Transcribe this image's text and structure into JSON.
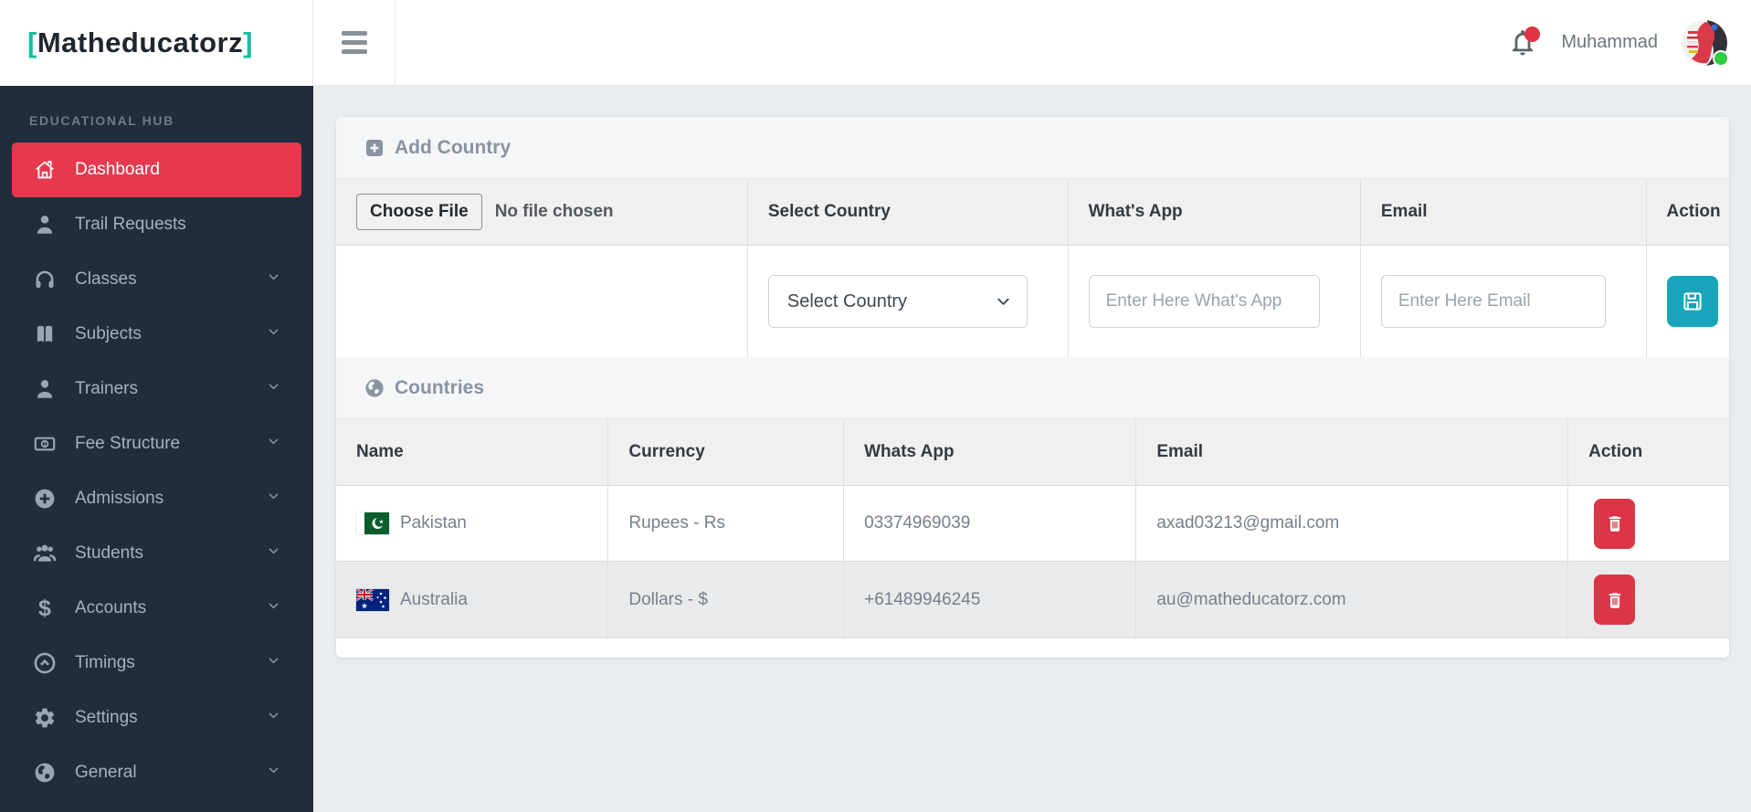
{
  "brand": {
    "bracket_left": "[",
    "name": "Matheducatorz",
    "bracket_right": "]"
  },
  "sidebar": {
    "section_label": "EDUCATIONAL HUB",
    "items": [
      {
        "label": "Dashboard",
        "icon": "home-icon",
        "active": true
      },
      {
        "label": "Trail Requests",
        "icon": "person-icon",
        "active": false
      },
      {
        "label": "Classes",
        "icon": "headphones-icon",
        "active": false
      },
      {
        "label": "Subjects",
        "icon": "book-icon",
        "active": false
      },
      {
        "label": "Trainers",
        "icon": "person-icon",
        "active": false
      },
      {
        "label": "Fee Structure",
        "icon": "money-bill-icon",
        "active": false
      },
      {
        "label": "Admissions",
        "icon": "plus-circle-icon",
        "active": false
      },
      {
        "label": "Students",
        "icon": "users-icon",
        "active": false
      },
      {
        "label": "Accounts",
        "icon": "dollar-icon",
        "active": false
      },
      {
        "label": "Timings",
        "icon": "clock-icon",
        "active": false
      },
      {
        "label": "Settings",
        "icon": "gear-icon",
        "active": false
      },
      {
        "label": "General",
        "icon": "globe-icon",
        "active": false
      }
    ]
  },
  "topbar": {
    "user_name": "Muhammad"
  },
  "add_country": {
    "title": "Add Country",
    "file_button": "Choose File",
    "file_status": "No file chosen",
    "col_select": "Select Country",
    "col_whatsapp": "What's App",
    "col_email": "Email",
    "col_action": "Action",
    "select_value": "Select Country",
    "whatsapp_placeholder": "Enter Here What's App",
    "email_placeholder": "Enter Here Email"
  },
  "countries": {
    "title": "Countries",
    "headers": [
      "Name",
      "Currency",
      "Whats App",
      "Email",
      "Action"
    ],
    "rows": [
      {
        "name": "Pakistan",
        "flag": "pakistan-flag",
        "currency": "Rupees - Rs",
        "whatsapp": "03374969039",
        "email": "axad03213@gmail.com"
      },
      {
        "name": "Australia",
        "flag": "australia-flag",
        "currency": "Dollars - $",
        "whatsapp": "+61489946245",
        "email": "au@matheducatorz.com"
      }
    ]
  },
  "colors": {
    "sidebar_bg": "#222d3b",
    "active_red": "#e6394f",
    "danger_red": "#dc3545",
    "save_teal": "#18a4ba",
    "brand_teal": "#1abc9c",
    "page_bg": "#e9ecef",
    "online_green": "#2ecc40"
  }
}
